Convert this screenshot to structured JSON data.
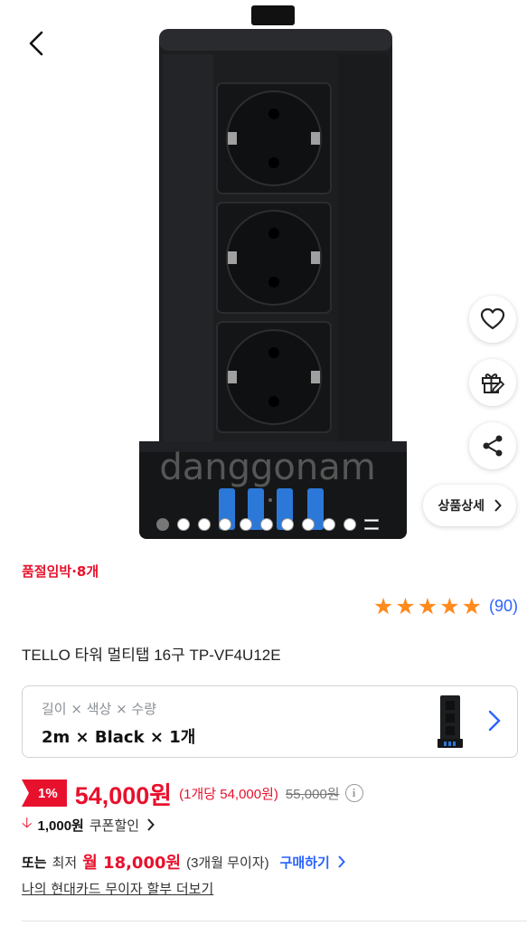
{
  "hero": {
    "watermark": "danggonam",
    "slide_count": 10,
    "active_slide": 0
  },
  "actions": {
    "back_icon": "chevron-left-icon",
    "like_icon": "heart-icon",
    "gift_icon": "gift-icon",
    "share_icon": "share-icon",
    "detail_label": "상품상세"
  },
  "stock_warning": "품절임박·8개",
  "rating": {
    "stars": 5,
    "count_text": "(90)"
  },
  "product_title": "TELLO 타워 멀티탭 16구 TP-VF4U12E",
  "option": {
    "label": "길이 × 색상 × 수량",
    "value": "2m × Black × 1개"
  },
  "price": {
    "discount": "1%",
    "current": "54,000원",
    "unit": "(1개당 54,000원)",
    "original": "55,000원"
  },
  "coupon": {
    "amount": "1,000원",
    "label": "쿠폰할인"
  },
  "installment": {
    "prefix": "또는",
    "minimum": "최저",
    "monthly": "월 18,000원",
    "months": "(3개월 무이자)",
    "buy_label": "구매하기"
  },
  "card_link": "나의 현대카드 무이자 할부 더보기",
  "colors": {
    "accent_red": "#e8112d",
    "link_blue": "#2a63ff",
    "star_orange": "#ff8a1d"
  }
}
